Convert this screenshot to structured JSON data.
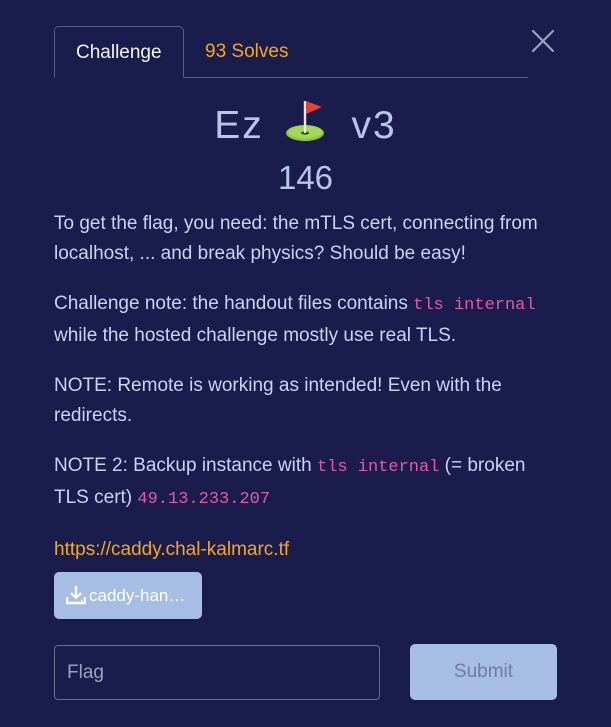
{
  "tabs": {
    "challenge_label": "Challenge",
    "solves_label": "93 Solves"
  },
  "challenge": {
    "title_left": "Ez",
    "title_icon": "golf-flag-icon",
    "title_right": "v3",
    "points": "146",
    "paragraphs": [
      {
        "text": "To get the flag, you need: the mTLS cert, connecting from localhost, ... and break physics? Should be easy!"
      },
      {
        "before": "Challenge note: the handout files contains ",
        "code": "tls internal",
        "after": " while the hosted challenge mostly use real TLS."
      },
      {
        "text": "NOTE: Remote is working as intended! Even with the redirects."
      },
      {
        "before": "NOTE 2: Backup instance with ",
        "code": "tls internal",
        "middle": " (= broken TLS cert) ",
        "code2": "49.13.233.207"
      }
    ],
    "link": "https://caddy.chal-kalmarc.tf",
    "file_label": "caddy-han…"
  },
  "form": {
    "flag_placeholder": "Flag",
    "flag_value": "",
    "submit_label": "Submit"
  },
  "colors": {
    "background": "#1a1d4b",
    "accent": "#f5a623",
    "code": "#e15ba4",
    "button": "#a6bde4"
  }
}
